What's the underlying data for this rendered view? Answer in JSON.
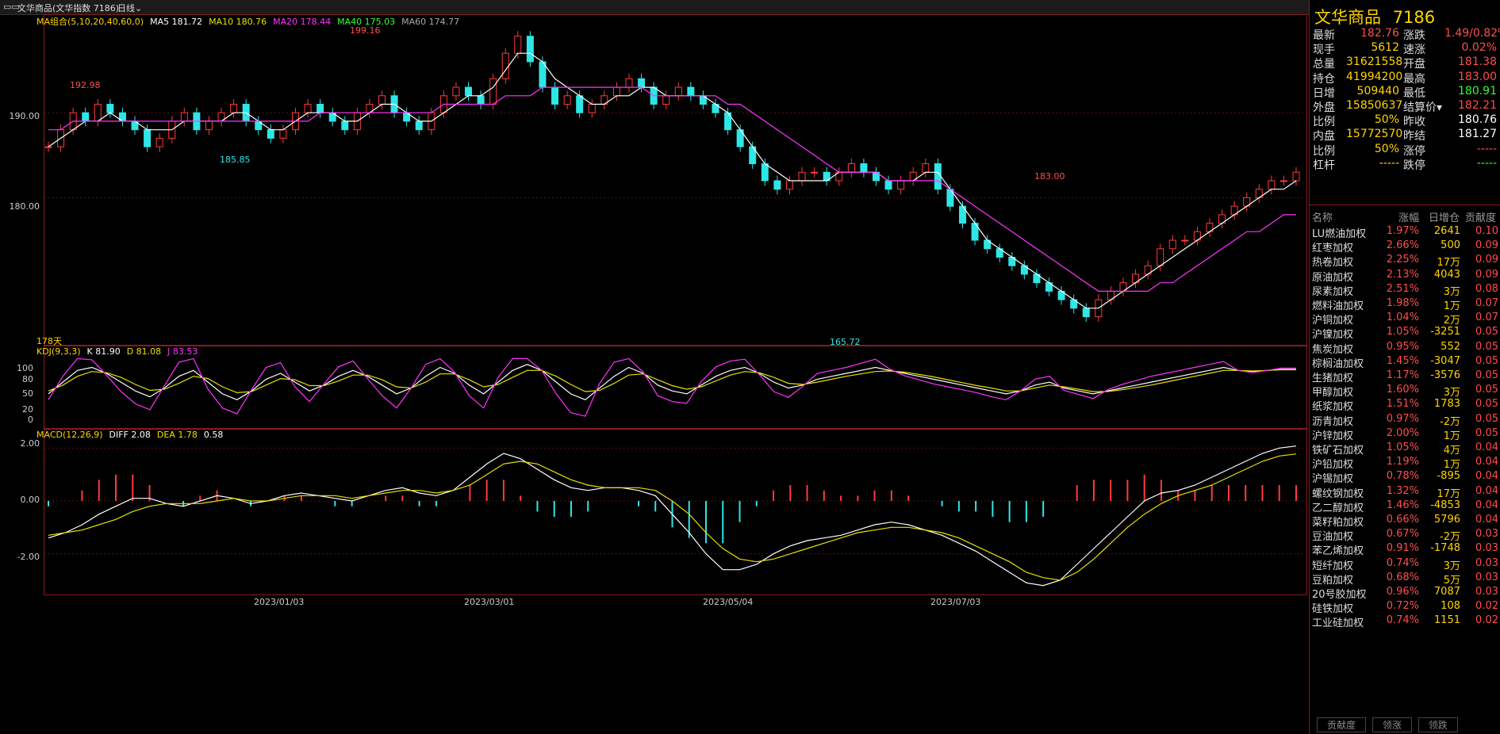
{
  "topbar": {
    "title": "文华商品(文华指数 7186)",
    "period": "日线"
  },
  "main": {
    "legend": [
      {
        "text": "MA组合(5,10,20,40,60,0)",
        "color": "#ffd400"
      },
      {
        "text": "MA5 181.72",
        "color": "#ffffff"
      },
      {
        "text": "MA10 180.76",
        "color": "#e8e000"
      },
      {
        "text": "MA20 178.44",
        "color": "#ff33ff"
      },
      {
        "text": "MA40 175.03",
        "color": "#33ff33"
      },
      {
        "text": "MA60 174.77",
        "color": "#aaaaaa"
      }
    ],
    "y_ticks": [
      "190.00",
      "180.00"
    ],
    "high_label": "199.16",
    "label_192": "192.98",
    "label_185": "185.85",
    "low_label": "165.72",
    "last_high_label": "183.00",
    "days": "178天"
  },
  "kdj": {
    "legend": [
      {
        "text": "KDJ(9,3,3)",
        "color": "#ffd400"
      },
      {
        "text": "K 81.90",
        "color": "#ffffff"
      },
      {
        "text": "D 81.08",
        "color": "#e8e000"
      },
      {
        "text": "J 83.53",
        "color": "#ff33ff"
      }
    ],
    "y_ticks": [
      "100",
      "80",
      "50",
      "20",
      "0"
    ]
  },
  "macd": {
    "legend": [
      {
        "text": "MACD(12,26,9)",
        "color": "#ffd400"
      },
      {
        "text": "DIFF 2.08",
        "color": "#ffffff"
      },
      {
        "text": "DEA 1.78",
        "color": "#e8e000"
      },
      {
        "text": "0.58",
        "color": "#ffffff"
      }
    ],
    "y_ticks": [
      "2.00",
      "0.00",
      "-2.00"
    ]
  },
  "x_ticks": [
    "2023/01/03",
    "2023/03/01",
    "2023/05/04",
    "2023/07/03"
  ],
  "quote": {
    "name": "文华商品",
    "code": "7186",
    "rows": [
      {
        "l1": "最新",
        "v1": "182.76",
        "c1": "#ff4d4d",
        "l2": "涨跌",
        "v2": "1.49/0.82%",
        "c2": "#ff4d4d"
      },
      {
        "l1": "现手",
        "v1": "5612",
        "c1": "#ffd400",
        "l2": "速涨",
        "v2": "0.02%",
        "c2": "#ff4d4d"
      },
      {
        "l1": "总量",
        "v1": "31621558",
        "c1": "#ffd400",
        "l2": "开盘",
        "v2": "181.38",
        "c2": "#ff4d4d"
      },
      {
        "l1": "持仓",
        "v1": "41994200",
        "c1": "#ffd400",
        "l2": "最高",
        "v2": "183.00",
        "c2": "#ff4d4d"
      },
      {
        "l1": "日增",
        "v1": "509440",
        "c1": "#ffd400",
        "l2": "最低",
        "v2": "180.91",
        "c2": "#33ff33"
      },
      {
        "l1": "外盘",
        "v1": "15850637",
        "c1": "#ffd400",
        "l2": "结算价▾",
        "v2": "182.21",
        "c2": "#ff4d4d"
      },
      {
        "l1": "比例",
        "v1": "50%",
        "c1": "#ffd400",
        "l2": "昨收",
        "v2": "180.76",
        "c2": "#ffffff"
      },
      {
        "l1": "内盘",
        "v1": "15772570",
        "c1": "#ffd400",
        "l2": "昨结",
        "v2": "181.27",
        "c2": "#ffffff"
      },
      {
        "l1": "比例",
        "v1": "50%",
        "c1": "#ffd400",
        "l2": "涨停",
        "v2": "-----",
        "c2": "#ff4d4d"
      },
      {
        "l1": "杠杆",
        "v1": "-----",
        "c1": "#ffd400",
        "l2": "跌停",
        "v2": "-----",
        "c2": "#33ff33"
      }
    ]
  },
  "contrib": {
    "headers": [
      "名称",
      "涨幅",
      "日增仓",
      "贡献度"
    ],
    "rows": [
      [
        "LU燃油加权",
        "1.97%",
        "2641",
        "0.10"
      ],
      [
        "红枣加权",
        "2.66%",
        "500",
        "0.09"
      ],
      [
        "热卷加权",
        "2.25%",
        "17万",
        "0.09"
      ],
      [
        "原油加权",
        "2.13%",
        "4043",
        "0.09"
      ],
      [
        "尿素加权",
        "2.51%",
        "3万",
        "0.08"
      ],
      [
        "燃料油加权",
        "1.98%",
        "1万",
        "0.07"
      ],
      [
        "沪铜加权",
        "1.04%",
        "2万",
        "0.07"
      ],
      [
        "沪镍加权",
        "1.05%",
        "-3251",
        "0.05"
      ],
      [
        "焦炭加权",
        "0.95%",
        "552",
        "0.05"
      ],
      [
        "棕榈油加权",
        "1.45%",
        "-3047",
        "0.05"
      ],
      [
        "生猪加权",
        "1.17%",
        "-3576",
        "0.05"
      ],
      [
        "甲醇加权",
        "1.60%",
        "3万",
        "0.05"
      ],
      [
        "纸浆加权",
        "1.51%",
        "1783",
        "0.05"
      ],
      [
        "沥青加权",
        "0.97%",
        "-2万",
        "0.05"
      ],
      [
        "沪锌加权",
        "2.00%",
        "1万",
        "0.05"
      ],
      [
        "铁矿石加权",
        "1.05%",
        "4万",
        "0.04"
      ],
      [
        "沪铅加权",
        "1.19%",
        "1万",
        "0.04"
      ],
      [
        "沪锡加权",
        "0.78%",
        "-895",
        "0.04"
      ],
      [
        "螺纹钢加权",
        "1.32%",
        "17万",
        "0.04"
      ],
      [
        "乙二醇加权",
        "1.46%",
        "-4853",
        "0.04"
      ],
      [
        "菜籽粕加权",
        "0.66%",
        "5796",
        "0.04"
      ],
      [
        "豆油加权",
        "0.67%",
        "-2万",
        "0.03"
      ],
      [
        "苯乙烯加权",
        "0.91%",
        "-1748",
        "0.03"
      ],
      [
        "短纤加权",
        "0.74%",
        "3万",
        "0.03"
      ],
      [
        "豆粕加权",
        "0.68%",
        "5万",
        "0.03"
      ],
      [
        "20号胶加权",
        "0.96%",
        "7087",
        "0.03"
      ],
      [
        "硅铁加权",
        "0.72%",
        "108",
        "0.02"
      ],
      [
        "工业硅加权",
        "0.74%",
        "1151",
        "0.02"
      ]
    ]
  },
  "bottom_tabs": [
    "贡献度",
    "领涨",
    "领跌"
  ],
  "chart_data": [
    {
      "type": "line",
      "name_note": "candlestick price panel rendered as close line plus MAs",
      "x": [
        "2023/01/03",
        "2023/03/01",
        "2023/05/04",
        "2023/07/03"
      ],
      "ylim": [
        164,
        200
      ],
      "closes": [
        186,
        188,
        190,
        189,
        191,
        190,
        189,
        188,
        186,
        187,
        189,
        190,
        188,
        189,
        190,
        191,
        189,
        188,
        187,
        188,
        190,
        191,
        190,
        189,
        188,
        190,
        191,
        192,
        190,
        189,
        188,
        190,
        192,
        193,
        192,
        191,
        194,
        197,
        199,
        196,
        193,
        191,
        192,
        190,
        191,
        192,
        193,
        194,
        193,
        191,
        192,
        193,
        192,
        191,
        190,
        188,
        186,
        184,
        182,
        181,
        182,
        183,
        183,
        182,
        183,
        184,
        183,
        182,
        181,
        182,
        183,
        184,
        181,
        179,
        177,
        175,
        174,
        173,
        172,
        171,
        170,
        169,
        168,
        167,
        166,
        168,
        169,
        170,
        171,
        172,
        174,
        175,
        175,
        176,
        177,
        178,
        179,
        180,
        181,
        182,
        182,
        183
      ],
      "ma5": [
        186,
        187,
        188,
        189,
        189,
        190,
        189,
        189,
        188,
        188,
        188,
        189,
        189,
        189,
        189,
        190,
        190,
        189,
        188,
        188,
        189,
        190,
        190,
        190,
        189,
        189,
        190,
        191,
        191,
        190,
        189,
        189,
        190,
        191,
        192,
        192,
        193,
        195,
        197,
        197,
        196,
        194,
        193,
        192,
        191,
        191,
        192,
        192,
        193,
        193,
        192,
        192,
        192,
        192,
        191,
        190,
        188,
        186,
        184,
        183,
        182,
        182,
        182,
        182,
        183,
        183,
        183,
        183,
        182,
        182,
        182,
        183,
        183,
        181,
        179,
        177,
        175,
        174,
        173,
        172,
        171,
        170,
        169,
        168,
        167,
        167,
        168,
        169,
        170,
        171,
        172,
        173,
        174,
        175,
        176,
        177,
        178,
        179,
        180,
        181,
        181,
        182
      ],
      "ma20": [
        188,
        188,
        189,
        189,
        189,
        189,
        189,
        189,
        189,
        189,
        189,
        189,
        189,
        189,
        189,
        189,
        189,
        189,
        189,
        189,
        189,
        189,
        190,
        190,
        190,
        190,
        190,
        190,
        190,
        190,
        190,
        190,
        191,
        191,
        191,
        191,
        191,
        192,
        192,
        192,
        193,
        193,
        193,
        193,
        193,
        193,
        193,
        193,
        193,
        192,
        192,
        192,
        192,
        192,
        192,
        191,
        191,
        190,
        189,
        188,
        187,
        186,
        185,
        184,
        183,
        183,
        183,
        183,
        182,
        182,
        182,
        182,
        182,
        181,
        180,
        179,
        178,
        177,
        176,
        175,
        174,
        173,
        172,
        171,
        170,
        169,
        169,
        169,
        169,
        169,
        170,
        170,
        171,
        172,
        173,
        174,
        175,
        176,
        176,
        177,
        178,
        178
      ]
    },
    {
      "type": "line",
      "title": "KDJ(9,3,3)",
      "ylim": [
        0,
        100
      ],
      "series": [
        {
          "name": "K",
          "values": [
            40,
            60,
            80,
            85,
            75,
            60,
            45,
            35,
            50,
            70,
            80,
            60,
            40,
            30,
            45,
            65,
            75,
            60,
            45,
            55,
            70,
            80,
            70,
            55,
            40,
            50,
            70,
            85,
            75,
            55,
            40,
            60,
            80,
            90,
            80,
            60,
            40,
            30,
            50,
            70,
            85,
            75,
            55,
            45,
            40,
            55,
            70,
            80,
            85,
            75,
            60,
            50,
            55,
            65,
            70,
            75,
            80,
            85,
            80,
            75,
            70,
            65,
            60,
            55,
            50,
            45,
            40,
            45,
            55,
            60,
            50,
            45,
            40,
            45,
            50,
            55,
            60,
            65,
            70,
            75,
            80,
            85,
            80,
            78,
            80,
            82,
            82
          ]
        },
        {
          "name": "D",
          "values": [
            45,
            55,
            70,
            78,
            76,
            68,
            56,
            46,
            48,
            58,
            70,
            66,
            52,
            42,
            44,
            55,
            66,
            64,
            54,
            54,
            62,
            72,
            72,
            64,
            52,
            50,
            60,
            74,
            74,
            64,
            52,
            56,
            68,
            80,
            80,
            70,
            56,
            44,
            46,
            58,
            72,
            74,
            64,
            54,
            48,
            52,
            62,
            72,
            78,
            76,
            68,
            58,
            56,
            60,
            65,
            70,
            74,
            78,
            79,
            77,
            73,
            69,
            64,
            59,
            54,
            50,
            45,
            45,
            50,
            55,
            52,
            48,
            44,
            44,
            47,
            51,
            55,
            60,
            65,
            70,
            75,
            80,
            80,
            79,
            80,
            81,
            81
          ]
        },
        {
          "name": "J",
          "values": [
            30,
            70,
            100,
            98,
            72,
            44,
            23,
            13,
            54,
            94,
            100,
            48,
            16,
            6,
            47,
            85,
            93,
            52,
            27,
            57,
            86,
            96,
            66,
            37,
            16,
            50,
            90,
            100,
            77,
            37,
            16,
            68,
            100,
            100,
            80,
            40,
            8,
            2,
            58,
            94,
            100,
            77,
            37,
            27,
            24,
            61,
            86,
            96,
            99,
            73,
            44,
            34,
            53,
            75,
            80,
            85,
            92,
            99,
            82,
            71,
            64,
            57,
            52,
            47,
            42,
            35,
            30,
            45,
            65,
            70,
            46,
            39,
            32,
            47,
            56,
            63,
            70,
            75,
            80,
            85,
            90,
            95,
            80,
            76,
            80,
            84,
            84
          ]
        }
      ]
    },
    {
      "type": "bar",
      "title": "MACD(12,26,9)",
      "ylim": [
        -3.3,
        2.4
      ],
      "series": [
        {
          "name": "DIFF",
          "values": [
            -1.4,
            -1.2,
            -0.9,
            -0.5,
            -0.2,
            0.1,
            0.1,
            -0.1,
            -0.2,
            0.0,
            0.2,
            0.1,
            -0.1,
            0.0,
            0.2,
            0.3,
            0.2,
            0.1,
            0.0,
            0.2,
            0.4,
            0.5,
            0.3,
            0.2,
            0.4,
            0.9,
            1.4,
            1.8,
            1.6,
            1.2,
            0.8,
            0.5,
            0.4,
            0.5,
            0.5,
            0.4,
            0.2,
            -0.5,
            -1.2,
            -2.0,
            -2.6,
            -2.6,
            -2.4,
            -2.0,
            -1.7,
            -1.5,
            -1.4,
            -1.3,
            -1.1,
            -0.9,
            -0.8,
            -0.9,
            -1.1,
            -1.3,
            -1.6,
            -1.9,
            -2.3,
            -2.7,
            -3.1,
            -3.2,
            -3.0,
            -2.4,
            -1.8,
            -1.2,
            -0.6,
            0.0,
            0.3,
            0.4,
            0.6,
            0.9,
            1.2,
            1.5,
            1.8,
            2.0,
            2.08
          ]
        },
        {
          "name": "DEA",
          "values": [
            -1.3,
            -1.2,
            -1.1,
            -0.9,
            -0.7,
            -0.4,
            -0.2,
            -0.1,
            -0.1,
            -0.1,
            0.0,
            0.1,
            0.0,
            0.0,
            0.1,
            0.2,
            0.2,
            0.2,
            0.1,
            0.2,
            0.3,
            0.4,
            0.4,
            0.3,
            0.4,
            0.6,
            1.0,
            1.4,
            1.5,
            1.4,
            1.1,
            0.8,
            0.6,
            0.5,
            0.5,
            0.5,
            0.4,
            0.0,
            -0.5,
            -1.2,
            -1.8,
            -2.2,
            -2.3,
            -2.2,
            -2.0,
            -1.8,
            -1.6,
            -1.4,
            -1.2,
            -1.1,
            -1.0,
            -1.0,
            -1.1,
            -1.2,
            -1.4,
            -1.7,
            -2.0,
            -2.3,
            -2.7,
            -2.9,
            -3.0,
            -2.7,
            -2.2,
            -1.6,
            -1.0,
            -0.5,
            -0.1,
            0.2,
            0.4,
            0.6,
            0.9,
            1.2,
            1.5,
            1.7,
            1.78
          ]
        }
      ]
    }
  ]
}
